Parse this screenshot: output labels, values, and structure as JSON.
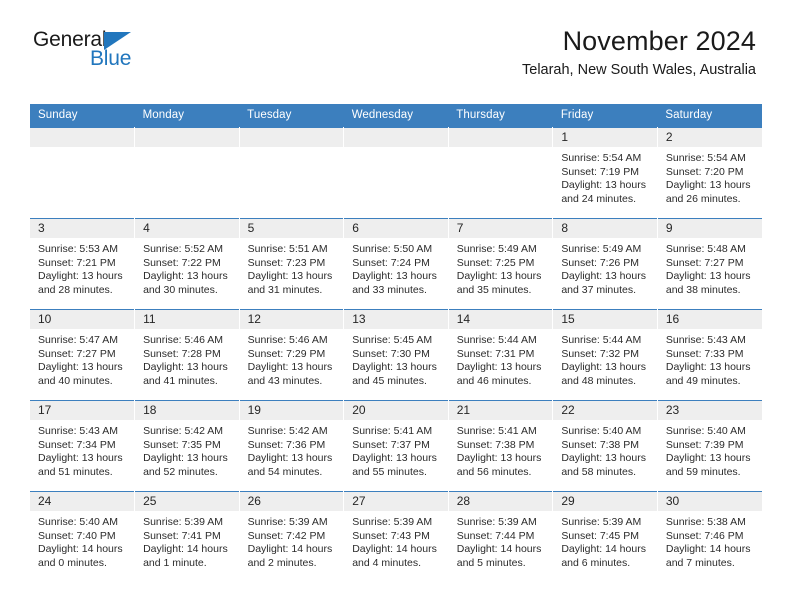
{
  "brand": {
    "name_part1": "General",
    "name_part2": "Blue",
    "accent_color": "#2176bd"
  },
  "header": {
    "title": "November 2024",
    "subtitle": "Telarah, New South Wales, Australia"
  },
  "theme": {
    "header_bg": "#3c7fbe",
    "daynum_bg": "#eeeeee",
    "page_bg": "#ffffff"
  },
  "weekday_headers": [
    "Sunday",
    "Monday",
    "Tuesday",
    "Wednesday",
    "Thursday",
    "Friday",
    "Saturday"
  ],
  "labels": {
    "sunrise_prefix": "Sunrise:",
    "sunset_prefix": "Sunset:",
    "daylight_prefix": "Daylight:"
  },
  "weeks": [
    [
      {
        "day": "",
        "sunrise": "",
        "sunset": "",
        "daylight": "",
        "empty": true
      },
      {
        "day": "",
        "sunrise": "",
        "sunset": "",
        "daylight": "",
        "empty": true
      },
      {
        "day": "",
        "sunrise": "",
        "sunset": "",
        "daylight": "",
        "empty": true
      },
      {
        "day": "",
        "sunrise": "",
        "sunset": "",
        "daylight": "",
        "empty": true
      },
      {
        "day": "",
        "sunrise": "",
        "sunset": "",
        "daylight": "",
        "empty": true
      },
      {
        "day": "1",
        "sunrise": "Sunrise: 5:54 AM",
        "sunset": "Sunset: 7:19 PM",
        "daylight": "Daylight: 13 hours and 24 minutes.",
        "empty": false
      },
      {
        "day": "2",
        "sunrise": "Sunrise: 5:54 AM",
        "sunset": "Sunset: 7:20 PM",
        "daylight": "Daylight: 13 hours and 26 minutes.",
        "empty": false
      }
    ],
    [
      {
        "day": "3",
        "sunrise": "Sunrise: 5:53 AM",
        "sunset": "Sunset: 7:21 PM",
        "daylight": "Daylight: 13 hours and 28 minutes.",
        "empty": false
      },
      {
        "day": "4",
        "sunrise": "Sunrise: 5:52 AM",
        "sunset": "Sunset: 7:22 PM",
        "daylight": "Daylight: 13 hours and 30 minutes.",
        "empty": false
      },
      {
        "day": "5",
        "sunrise": "Sunrise: 5:51 AM",
        "sunset": "Sunset: 7:23 PM",
        "daylight": "Daylight: 13 hours and 31 minutes.",
        "empty": false
      },
      {
        "day": "6",
        "sunrise": "Sunrise: 5:50 AM",
        "sunset": "Sunset: 7:24 PM",
        "daylight": "Daylight: 13 hours and 33 minutes.",
        "empty": false
      },
      {
        "day": "7",
        "sunrise": "Sunrise: 5:49 AM",
        "sunset": "Sunset: 7:25 PM",
        "daylight": "Daylight: 13 hours and 35 minutes.",
        "empty": false
      },
      {
        "day": "8",
        "sunrise": "Sunrise: 5:49 AM",
        "sunset": "Sunset: 7:26 PM",
        "daylight": "Daylight: 13 hours and 37 minutes.",
        "empty": false
      },
      {
        "day": "9",
        "sunrise": "Sunrise: 5:48 AM",
        "sunset": "Sunset: 7:27 PM",
        "daylight": "Daylight: 13 hours and 38 minutes.",
        "empty": false
      }
    ],
    [
      {
        "day": "10",
        "sunrise": "Sunrise: 5:47 AM",
        "sunset": "Sunset: 7:27 PM",
        "daylight": "Daylight: 13 hours and 40 minutes.",
        "empty": false
      },
      {
        "day": "11",
        "sunrise": "Sunrise: 5:46 AM",
        "sunset": "Sunset: 7:28 PM",
        "daylight": "Daylight: 13 hours and 41 minutes.",
        "empty": false
      },
      {
        "day": "12",
        "sunrise": "Sunrise: 5:46 AM",
        "sunset": "Sunset: 7:29 PM",
        "daylight": "Daylight: 13 hours and 43 minutes.",
        "empty": false
      },
      {
        "day": "13",
        "sunrise": "Sunrise: 5:45 AM",
        "sunset": "Sunset: 7:30 PM",
        "daylight": "Daylight: 13 hours and 45 minutes.",
        "empty": false
      },
      {
        "day": "14",
        "sunrise": "Sunrise: 5:44 AM",
        "sunset": "Sunset: 7:31 PM",
        "daylight": "Daylight: 13 hours and 46 minutes.",
        "empty": false
      },
      {
        "day": "15",
        "sunrise": "Sunrise: 5:44 AM",
        "sunset": "Sunset: 7:32 PM",
        "daylight": "Daylight: 13 hours and 48 minutes.",
        "empty": false
      },
      {
        "day": "16",
        "sunrise": "Sunrise: 5:43 AM",
        "sunset": "Sunset: 7:33 PM",
        "daylight": "Daylight: 13 hours and 49 minutes.",
        "empty": false
      }
    ],
    [
      {
        "day": "17",
        "sunrise": "Sunrise: 5:43 AM",
        "sunset": "Sunset: 7:34 PM",
        "daylight": "Daylight: 13 hours and 51 minutes.",
        "empty": false
      },
      {
        "day": "18",
        "sunrise": "Sunrise: 5:42 AM",
        "sunset": "Sunset: 7:35 PM",
        "daylight": "Daylight: 13 hours and 52 minutes.",
        "empty": false
      },
      {
        "day": "19",
        "sunrise": "Sunrise: 5:42 AM",
        "sunset": "Sunset: 7:36 PM",
        "daylight": "Daylight: 13 hours and 54 minutes.",
        "empty": false
      },
      {
        "day": "20",
        "sunrise": "Sunrise: 5:41 AM",
        "sunset": "Sunset: 7:37 PM",
        "daylight": "Daylight: 13 hours and 55 minutes.",
        "empty": false
      },
      {
        "day": "21",
        "sunrise": "Sunrise: 5:41 AM",
        "sunset": "Sunset: 7:38 PM",
        "daylight": "Daylight: 13 hours and 56 minutes.",
        "empty": false
      },
      {
        "day": "22",
        "sunrise": "Sunrise: 5:40 AM",
        "sunset": "Sunset: 7:38 PM",
        "daylight": "Daylight: 13 hours and 58 minutes.",
        "empty": false
      },
      {
        "day": "23",
        "sunrise": "Sunrise: 5:40 AM",
        "sunset": "Sunset: 7:39 PM",
        "daylight": "Daylight: 13 hours and 59 minutes.",
        "empty": false
      }
    ],
    [
      {
        "day": "24",
        "sunrise": "Sunrise: 5:40 AM",
        "sunset": "Sunset: 7:40 PM",
        "daylight": "Daylight: 14 hours and 0 minutes.",
        "empty": false
      },
      {
        "day": "25",
        "sunrise": "Sunrise: 5:39 AM",
        "sunset": "Sunset: 7:41 PM",
        "daylight": "Daylight: 14 hours and 1 minute.",
        "empty": false
      },
      {
        "day": "26",
        "sunrise": "Sunrise: 5:39 AM",
        "sunset": "Sunset: 7:42 PM",
        "daylight": "Daylight: 14 hours and 2 minutes.",
        "empty": false
      },
      {
        "day": "27",
        "sunrise": "Sunrise: 5:39 AM",
        "sunset": "Sunset: 7:43 PM",
        "daylight": "Daylight: 14 hours and 4 minutes.",
        "empty": false
      },
      {
        "day": "28",
        "sunrise": "Sunrise: 5:39 AM",
        "sunset": "Sunset: 7:44 PM",
        "daylight": "Daylight: 14 hours and 5 minutes.",
        "empty": false
      },
      {
        "day": "29",
        "sunrise": "Sunrise: 5:39 AM",
        "sunset": "Sunset: 7:45 PM",
        "daylight": "Daylight: 14 hours and 6 minutes.",
        "empty": false
      },
      {
        "day": "30",
        "sunrise": "Sunrise: 5:38 AM",
        "sunset": "Sunset: 7:46 PM",
        "daylight": "Daylight: 14 hours and 7 minutes.",
        "empty": false
      }
    ]
  ]
}
